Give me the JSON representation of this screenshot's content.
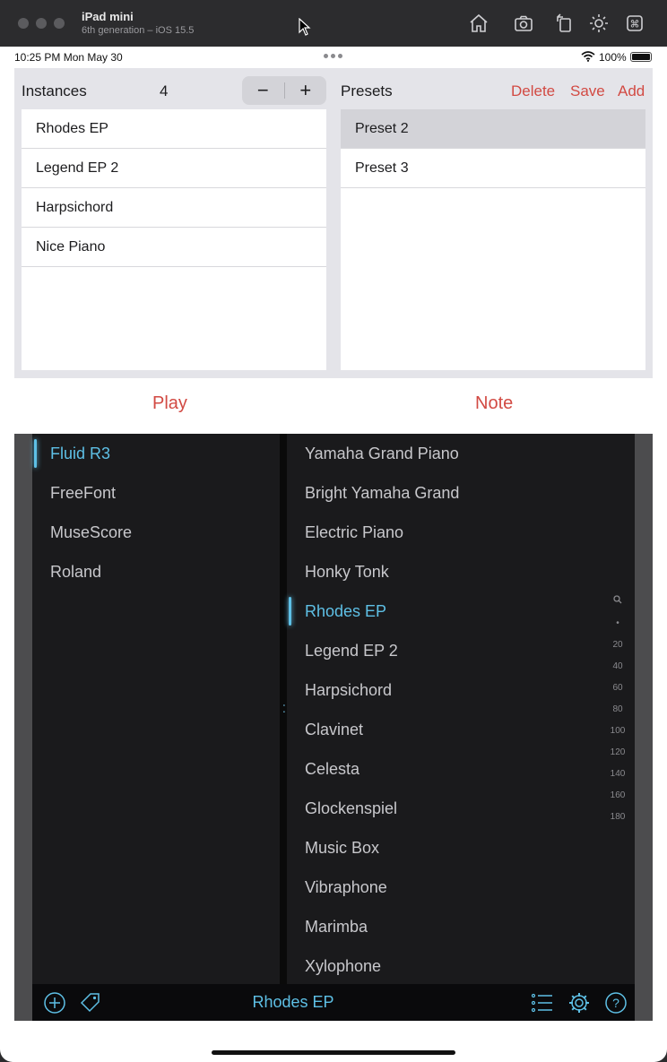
{
  "simulator": {
    "device_name": "iPad mini",
    "device_sub": "6th generation – iOS 15.5",
    "icons": [
      "home-icon",
      "screenshot-icon",
      "rotate-icon",
      "appearance-icon",
      "keyboard-icon"
    ]
  },
  "status_bar": {
    "time": "10:25 PM   Mon May 30",
    "battery": "100%"
  },
  "instances": {
    "title": "Instances",
    "count": "4",
    "minus": "−",
    "plus": "+",
    "items": [
      {
        "label": "Rhodes EP"
      },
      {
        "label": "Legend EP 2"
      },
      {
        "label": "Harpsichord"
      },
      {
        "label": "Nice Piano"
      }
    ]
  },
  "presets": {
    "title": "Presets",
    "delete_label": "Delete",
    "save_label": "Save",
    "add_label": "Add",
    "items": [
      {
        "label": "Preset 2",
        "selected": true
      },
      {
        "label": "Preset 3",
        "selected": false
      }
    ]
  },
  "tabs": {
    "play": "Play",
    "note": "Note"
  },
  "soundfonts": [
    {
      "label": "Fluid R3",
      "selected": true
    },
    {
      "label": "FreeFont",
      "selected": false
    },
    {
      "label": "MuseScore",
      "selected": false
    },
    {
      "label": "Roland",
      "selected": false
    }
  ],
  "patches": [
    {
      "label": "Yamaha Grand Piano",
      "selected": false
    },
    {
      "label": "Bright Yamaha Grand",
      "selected": false
    },
    {
      "label": "Electric Piano",
      "selected": false
    },
    {
      "label": "Honky Tonk",
      "selected": false
    },
    {
      "label": "Rhodes EP",
      "selected": true
    },
    {
      "label": "Legend EP 2",
      "selected": false
    },
    {
      "label": "Harpsichord",
      "selected": false
    },
    {
      "label": "Clavinet",
      "selected": false
    },
    {
      "label": "Celesta",
      "selected": false
    },
    {
      "label": "Glockenspiel",
      "selected": false
    },
    {
      "label": "Music Box",
      "selected": false
    },
    {
      "label": "Vibraphone",
      "selected": false
    },
    {
      "label": "Marimba",
      "selected": false
    },
    {
      "label": "Xylophone",
      "selected": false
    }
  ],
  "index_bar": [
    "search-icon",
    "•",
    "20",
    "40",
    "60",
    "80",
    "100",
    "120",
    "140",
    "160",
    "180"
  ],
  "bottom_bar": {
    "current_patch": "Rhodes EP",
    "icons": [
      "add-icon",
      "tag-icon",
      "list-icon",
      "settings-icon",
      "help-icon"
    ]
  },
  "colors": {
    "accent_red": "#d24a43",
    "accent_cyan": "#5ec0e6"
  }
}
